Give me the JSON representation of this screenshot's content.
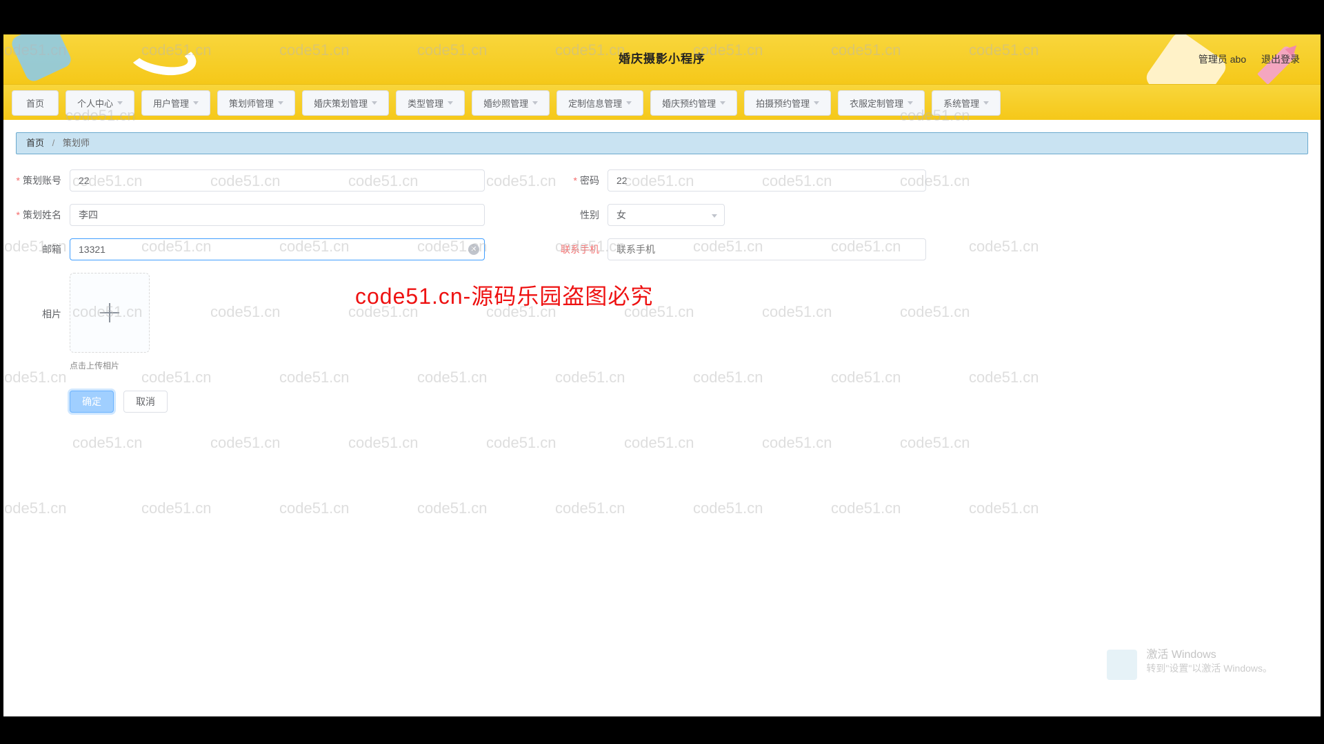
{
  "header": {
    "title": "婚庆摄影小程序",
    "admin_label": "管理员 abo",
    "logout_label": "退出登录"
  },
  "nav": {
    "items": [
      {
        "label": "首页",
        "dropdown": false
      },
      {
        "label": "个人中心",
        "dropdown": true
      },
      {
        "label": "用户管理",
        "dropdown": true
      },
      {
        "label": "策划师管理",
        "dropdown": true
      },
      {
        "label": "婚庆策划管理",
        "dropdown": true
      },
      {
        "label": "类型管理",
        "dropdown": true
      },
      {
        "label": "婚纱照管理",
        "dropdown": true
      },
      {
        "label": "定制信息管理",
        "dropdown": true
      },
      {
        "label": "婚庆预约管理",
        "dropdown": true
      },
      {
        "label": "拍摄预约管理",
        "dropdown": true
      },
      {
        "label": "衣服定制管理",
        "dropdown": true
      },
      {
        "label": "系统管理",
        "dropdown": true
      }
    ]
  },
  "breadcrumb": {
    "home": "首页",
    "sep": "/",
    "current": "策划师"
  },
  "form": {
    "account_label": "策划账号",
    "account_value": "22",
    "password_label": "密码",
    "password_value": "22",
    "name_label": "策划姓名",
    "name_value": "李四",
    "gender_label": "性别",
    "gender_value": "女",
    "email_label": "邮箱",
    "email_value": "13321",
    "phone_label": "联系手机",
    "phone_placeholder": "联系手机",
    "photo_label": "相片",
    "upload_hint": "点击上传相片"
  },
  "actions": {
    "confirm": "确定",
    "cancel": "取消"
  },
  "watermark": {
    "text": "code51.cn",
    "overlay": "code51.cn-源码乐园盗图必究",
    "activation_title": "激活 Windows",
    "activation_sub": "转到\"设置\"以激活 Windows。"
  }
}
